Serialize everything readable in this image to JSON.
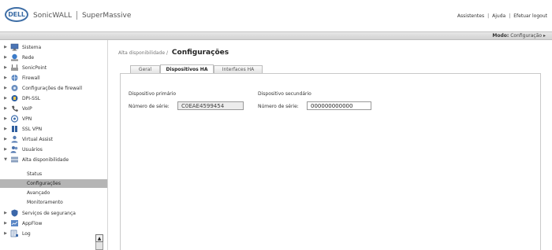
{
  "header": {
    "logo": "DELL",
    "brand": "SonicWALL",
    "product": "SuperMassive",
    "links": {
      "wizards": "Assistentes",
      "help": "Ajuda",
      "logout": "Efetuar logout"
    }
  },
  "modebar": {
    "mode_label": "Modo:",
    "mode_value": "Configuração ▸"
  },
  "sidebar": {
    "items": [
      {
        "label": "Sistema",
        "icon": "monitor-icon",
        "expanded": false
      },
      {
        "label": "Rede",
        "icon": "network-icon",
        "expanded": false
      },
      {
        "label": "SonicPoint",
        "icon": "access-point-icon",
        "expanded": false
      },
      {
        "label": "Firewall",
        "icon": "firewall-icon",
        "expanded": false
      },
      {
        "label": "Configurações de firewall",
        "icon": "firewall-settings-icon",
        "expanded": false
      },
      {
        "label": "DPI-SSL",
        "icon": "dpi-ssl-icon",
        "expanded": false
      },
      {
        "label": "VoIP",
        "icon": "phone-icon",
        "expanded": false
      },
      {
        "label": "VPN",
        "icon": "vpn-icon",
        "expanded": false
      },
      {
        "label": "SSL VPN",
        "icon": "ssl-vpn-icon",
        "expanded": false
      },
      {
        "label": "Virtual Assist",
        "icon": "virtual-assist-icon",
        "expanded": false
      },
      {
        "label": "Usuários",
        "icon": "users-icon",
        "expanded": false
      },
      {
        "label": "Alta disponibilidade",
        "icon": "high-availability-icon",
        "expanded": true
      }
    ],
    "subitems": [
      {
        "label": "Status",
        "selected": false
      },
      {
        "label": "Configurações",
        "selected": true
      },
      {
        "label": "Avançado",
        "selected": false
      },
      {
        "label": "Monitoramento",
        "selected": false
      }
    ],
    "items_after": [
      {
        "label": "Serviços de segurança",
        "icon": "shield-icon"
      },
      {
        "label": "AppFlow",
        "icon": "appflow-icon"
      },
      {
        "label": "Log",
        "icon": "log-icon"
      }
    ]
  },
  "main": {
    "breadcrumb": "Alta disponibilidade /",
    "title": "Configurações",
    "tabs": [
      {
        "label": "Geral",
        "active": false
      },
      {
        "label": "Dispositivos HA",
        "active": true
      },
      {
        "label": "Interfaces HA",
        "active": false
      }
    ],
    "primary": {
      "heading": "Dispositivo primário",
      "serial_label": "Número de série:",
      "serial_value": "C0EAE4599454"
    },
    "secondary": {
      "heading": "Dispositivo secundário",
      "serial_label": "Número de série:",
      "serial_value": "000000000000"
    }
  }
}
